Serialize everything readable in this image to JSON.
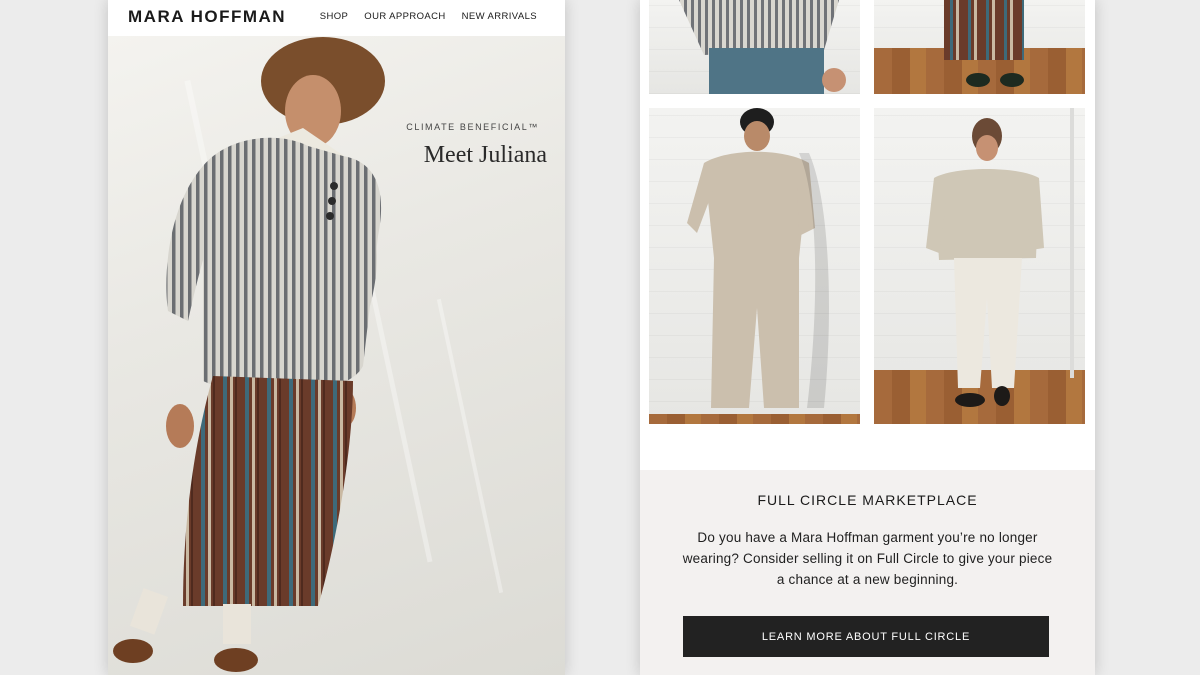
{
  "brand": {
    "logo": "MARA HOFFMAN"
  },
  "nav": {
    "items": [
      "SHOP",
      "OUR APPROACH",
      "NEW ARRIVALS"
    ]
  },
  "hero": {
    "kicker": "CLIMATE BENEFICIAL™",
    "title": "Meet Juliana"
  },
  "full_circle": {
    "title": "FULL CIRCLE MARKETPLACE",
    "body": "Do you have a Mara Hoffman garment you’re no longer wearing? Consider selling it on Full Circle to give your piece a chance at a new beginning.",
    "button_label": "LEARN MORE ABOUT FULL CIRCLE"
  },
  "colors": {
    "background": "#ececec",
    "button": "#222222",
    "section_bg": "#f3f1f0",
    "floor": "#a66a3c"
  }
}
